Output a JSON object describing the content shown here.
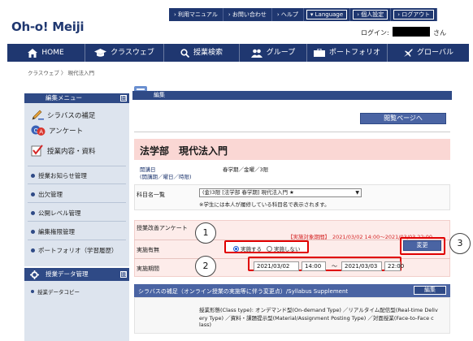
{
  "header": {
    "top_links": [
      "› 利用マニュアル",
      "› お問い合わせ",
      "› ヘルプ",
      "▾ Language",
      "› 個人設定",
      "› ログアウト"
    ],
    "logo": "Oh-o! Meiji",
    "login_label": "ログイン:",
    "login_suffix": "さん"
  },
  "nav": {
    "items": [
      {
        "label": "HOME",
        "icon": "home-icon"
      },
      {
        "label": "クラスウェブ",
        "icon": "graduation-cap-icon"
      },
      {
        "label": "授業検索",
        "icon": "search-icon"
      },
      {
        "label": "グループ",
        "icon": "group-icon"
      },
      {
        "label": "ポートフォリオ",
        "icon": "portfolio-icon"
      },
      {
        "label": "グローバル",
        "icon": "airplane-icon"
      }
    ]
  },
  "breadcrumb": "クラスウェブ 〉 現代法入門",
  "sidebar": {
    "heading": "編集メニュー",
    "toggle": "⊟",
    "items": [
      {
        "label": "シラバスの補足",
        "icon": "pencil-icon"
      },
      {
        "label": "アンケート",
        "icon": "qa-icon"
      },
      {
        "label": "授業内容・資料",
        "icon": "checklist-icon"
      },
      {
        "label": "授業お知らせ管理",
        "icon": "bullet-icon"
      },
      {
        "label": "出欠管理",
        "icon": "bullet-icon"
      },
      {
        "label": "公開レベル管理",
        "icon": "bullet-icon"
      },
      {
        "label": "編集権限管理",
        "icon": "bullet-icon"
      },
      {
        "label": "ポートフォリオ（学習履歴）",
        "icon": "bullet-icon"
      }
    ],
    "heading2": "授業データ管理",
    "items2": [
      {
        "label": "授業データコピー"
      }
    ]
  },
  "main": {
    "heading": "編集",
    "view_button": "閲覧ページへ",
    "title": "法学部　現代法入門",
    "info_label1": "開講日",
    "info_label2": "(開講期／曜日／時限)",
    "info_value": "春学期／金曜／3限",
    "course_label": "科目名一覧",
    "course_select": "(金)3限 [法学部 春学期] 現代法入門 ★",
    "course_note": "※学生には本人が履修している科目名で表示されます。",
    "survey_label": "授業改善アンケート",
    "survey_period_label": "【実施対象期間】",
    "survey_period": "2021/03/02 14:00〜2021/03/03 22:00",
    "enable_label": "実施有無",
    "radio_on": "実施する",
    "radio_off": "実施しない",
    "change_button": "変更",
    "period_label": "実施期間",
    "start_date": "2021/03/02",
    "start_time": "14:00",
    "tilde": "〜",
    "end_date": "2021/03/03",
    "end_time": "22:00",
    "syllabus_heading": "シラバスの補足（オンライン授業の実施等に伴う変更点）/Syllabus Supplement",
    "edit_button": "編集",
    "syllabus_text1": "授業形態(Class type): オンデマンド型(On-demand Type) ／リアルタイム配信型(Real-time Deliv",
    "syllabus_text2": "ery Type) ／資料・課題提示型(Material/Assignment Posting Type) ／対面授業(Face-to-Face c",
    "syllabus_text3": "lass)"
  },
  "callouts": [
    "1",
    "2",
    "3"
  ]
}
